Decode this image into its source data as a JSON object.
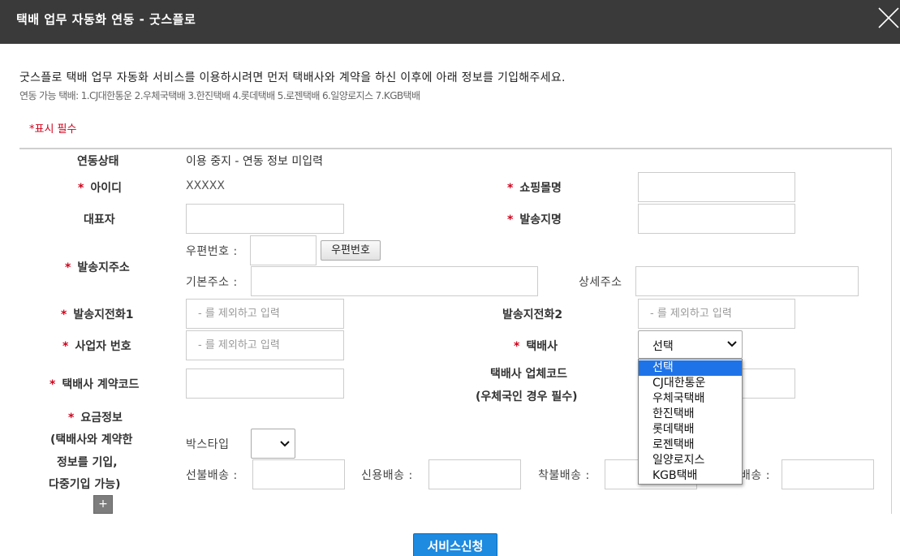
{
  "window": {
    "title": "택배 업무 자동화 연동 - 굿스플로",
    "close_icon": "close-icon"
  },
  "intro": {
    "text": "굿스플로 택배 업무 자동화 서비스를 이용하시려면 먼저 택배사와 계약을 하신 이후에 아래 정보를 기입해주세요.",
    "carriers": "연동 가능 택배: 1.CJ대한통운 2.우체국택배 3.한진택배 4.롯데택배 5.로젠택배 6.일양로지스 7.KGB택배",
    "required_note": "*표시 필수"
  },
  "form": {
    "link_status_label": "연동상태",
    "link_status_value": "이용 중지 - 연동 정보 미입력",
    "required_mark": "*",
    "id_label": "아이디",
    "id_value": "XXXXX",
    "mall_name_label": "쇼핑몰명",
    "mall_name_value": "",
    "ceo_label": "대표자",
    "ceo_value": "",
    "sender_name_label": "발송지명",
    "sender_name_value": "",
    "sender_address_label": "발송지주소",
    "zip_label": "우편번호 :",
    "zip_value": "",
    "zip_button": "우편번호",
    "base_address_label": "기본주소 :",
    "base_address_value": "",
    "detail_address_label": "상세주소",
    "detail_address_value": "",
    "phone1_label": "발송지전화1",
    "phone1_placeholder": "- 를 제외하고 입력",
    "phone2_label": "발송지전화2",
    "phone2_placeholder": "- 를 제외하고 입력",
    "biz_no_label": "사업자 번호",
    "biz_no_placeholder": "- 를 제외하고 입력",
    "carrier_label": "택배사",
    "carrier_selected": "선택",
    "carrier_options": [
      "선택",
      "CJ대한통운",
      "우체국택배",
      "한진택배",
      "롯데택배",
      "로젠택배",
      "일양로지스",
      "KGB택배"
    ],
    "contract_code_label": "택배사 계약코드",
    "contract_code_value": "",
    "vendor_code_label_1": "택배사 업체코드",
    "vendor_code_label_2": "(우체국인 경우 필수)",
    "vendor_code_value": "",
    "fee_label_1": "요금정보",
    "fee_label_2": "(택배사와 계약한",
    "fee_label_3": "정보를 기입,",
    "fee_label_4": "다중기입 가능)",
    "box_type_label": "박스타입",
    "box_type_selected": "",
    "prepaid_label": "선불배송 :",
    "prepaid_value": "",
    "credit_label": "신용배송 :",
    "credit_value": "",
    "cod_label": "착불배송 :",
    "cod_value": "",
    "other_label": "배송 :",
    "other_value": "",
    "add_button": "+"
  },
  "actions": {
    "apply_button": "서비스신청"
  },
  "colors": {
    "titlebar": "#3a3a3a",
    "required": "#d0021b",
    "apply": "#1e8ae0",
    "selected_option": "#1e73e8"
  }
}
